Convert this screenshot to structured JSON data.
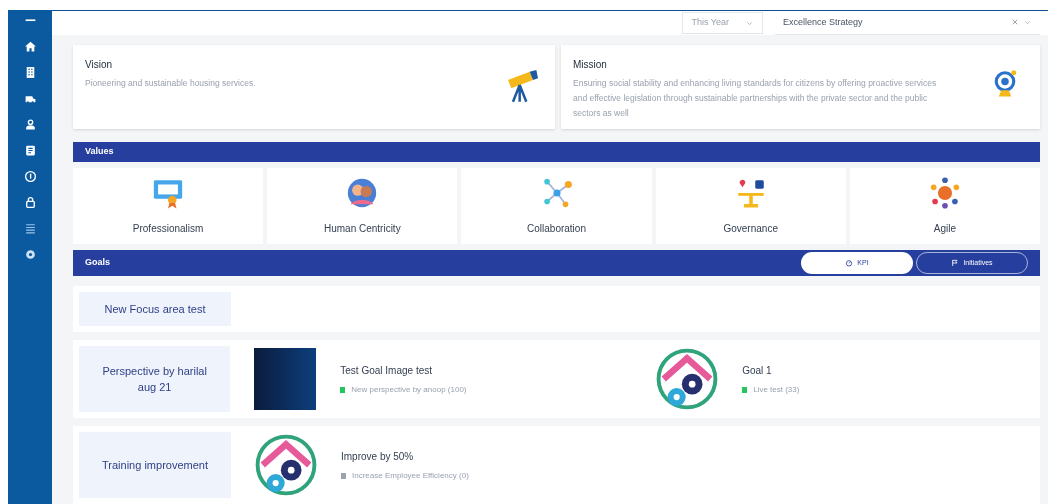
{
  "filters": {
    "period": "This Year",
    "strategy": "Excellence Strategy"
  },
  "vision": {
    "title": "Vision",
    "text": "Pioneering and sustainable housing services."
  },
  "mission": {
    "title": "Mission",
    "text": "Ensuring social stability and enhancing living standards for citizens by offering proactive services and effective legislation through sustainable partnerships with the private sector and the public sectors as well"
  },
  "values": {
    "title": "Values",
    "items": [
      {
        "label": "Professionalism",
        "kind": "certificate"
      },
      {
        "label": "Human Centricity",
        "kind": "people"
      },
      {
        "label": "Collaboration",
        "kind": "network"
      },
      {
        "label": "Governance",
        "kind": "scale"
      },
      {
        "label": "Agile",
        "kind": "team"
      }
    ]
  },
  "goals": {
    "title": "Goals",
    "toggles": [
      {
        "label": "KPI",
        "selected": true
      },
      {
        "label": "Initiatives",
        "selected": false
      }
    ],
    "perspectives": [
      {
        "name": "New Focus area test"
      },
      {
        "name": "Perspective by harilal aug 21",
        "goals": [
          {
            "title": "Test Goal Image test",
            "kind": "photo",
            "status": "New perspective by anoop (100)",
            "color": "#22c55e"
          },
          {
            "title": "Goal 1",
            "kind": "house",
            "status": "Live test (33)",
            "color": "#22c55e"
          }
        ]
      },
      {
        "name": "Training improvement",
        "goals": [
          {
            "title": "Improve by 50%",
            "kind": "house",
            "status": "Increase Employee Efficiency (0)",
            "color": "#9ca3af"
          }
        ]
      }
    ]
  }
}
